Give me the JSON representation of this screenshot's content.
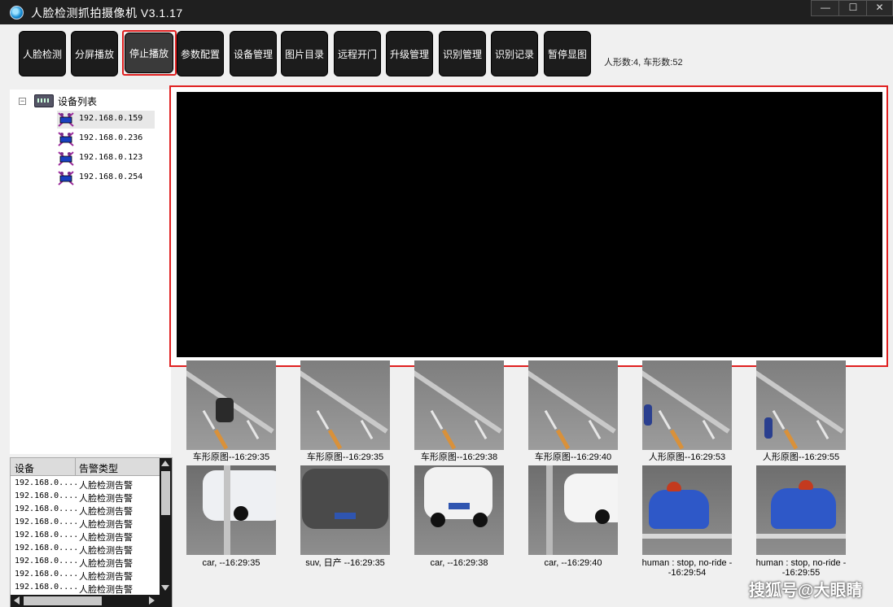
{
  "window": {
    "title": "人脸检测抓拍摄像机  V3.1.17",
    "min_glyph": "—",
    "max_glyph": "☐",
    "close_glyph": "✕"
  },
  "toolbar": {
    "buttons": [
      {
        "label": "人脸检测"
      },
      {
        "label": "分屏播放"
      },
      {
        "label": "停止播放"
      },
      {
        "label": "参数配置"
      },
      {
        "label": "设备管理"
      },
      {
        "label": "图片目录"
      },
      {
        "label": "远程开门"
      },
      {
        "label": "升级管理"
      },
      {
        "label": "识别管理"
      },
      {
        "label": "识别记录"
      },
      {
        "label": "暂停显图"
      }
    ],
    "counts": "人形数:4, 车形数:52"
  },
  "device_tree": {
    "expander": "−",
    "root_label": "设备列表",
    "devices": [
      {
        "ip": "192.168.0.159"
      },
      {
        "ip": "192.168.0.236"
      },
      {
        "ip": "192.168.0.123"
      },
      {
        "ip": "192.168.0.254"
      }
    ]
  },
  "alarm_table": {
    "columns": [
      "设备",
      "告警类型"
    ],
    "rows": [
      {
        "device": "192.168.0....",
        "type": "人脸检测告警"
      },
      {
        "device": "192.168.0....",
        "type": "人脸检测告警"
      },
      {
        "device": "192.168.0....",
        "type": "人脸检测告警"
      },
      {
        "device": "192.168.0....",
        "type": "人脸检测告警"
      },
      {
        "device": "192.168.0....",
        "type": "人脸检测告警"
      },
      {
        "device": "192.168.0....",
        "type": "人脸检测告警"
      },
      {
        "device": "192.168.0....",
        "type": "人脸检测告警"
      },
      {
        "device": "192.168.0....",
        "type": "人脸检测告警"
      },
      {
        "device": "192.168.0....",
        "type": "人脸检测告警"
      }
    ]
  },
  "snapshots_top": [
    {
      "caption": "车形原图--16:29:35"
    },
    {
      "caption": "车形原图--16:29:35"
    },
    {
      "caption": "车形原图--16:29:38"
    },
    {
      "caption": "车形原图--16:29:40"
    },
    {
      "caption": "人形原图--16:29:53"
    },
    {
      "caption": "人形原图--16:29:55"
    }
  ],
  "snapshots_bottom": [
    {
      "caption": "car, --16:29:35"
    },
    {
      "caption": "suv, 日产 --16:29:35"
    },
    {
      "caption": "car, --16:29:38"
    },
    {
      "caption": "car, --16:29:40"
    },
    {
      "caption": "human : stop, no-ride --16:29:54"
    },
    {
      "caption": "human : stop, no-ride --16:29:55"
    }
  ],
  "watermark": "搜狐号@大眼睛",
  "colors": {
    "highlight": "#e02020",
    "toolbar_button": "#1c1c1c",
    "title_bar": "#1f1f1f"
  }
}
